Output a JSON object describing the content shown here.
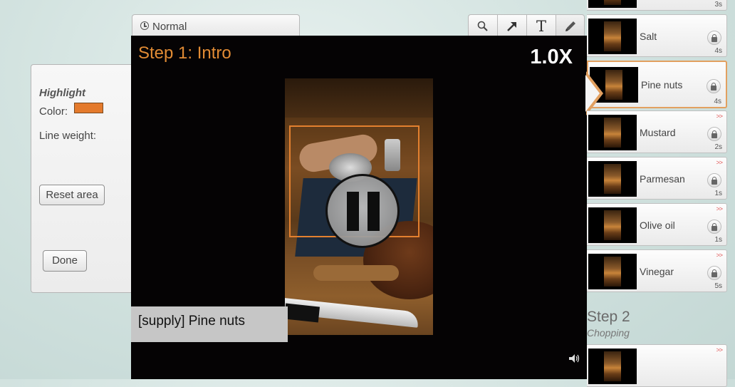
{
  "mode_tab": {
    "label": "Normal",
    "icon": "clock-icon"
  },
  "tools": [
    {
      "name": "search-tool-button",
      "icon": "magnifier-icon"
    },
    {
      "name": "arrow-tool-button",
      "icon": "arrow-icon"
    },
    {
      "name": "text-tool-button",
      "icon": "text-icon",
      "glyph": "T"
    },
    {
      "name": "pencil-tool-button",
      "icon": "pencil-icon"
    }
  ],
  "panel": {
    "title": "Highlight",
    "color_label": "Color:",
    "color_value": "#e47a2c",
    "line_weight_label": "Line weight:",
    "reset_label": "Reset area",
    "done_label": "Done"
  },
  "video": {
    "step_title": "Step 1: Intro",
    "speed": "1.0X",
    "caption": "[supply] Pine nuts",
    "highlight_color": "#e3802f",
    "state": "playing"
  },
  "steps_list": {
    "items": [
      {
        "name": "",
        "duration": "3s",
        "chevron": ""
      },
      {
        "name": "Salt",
        "duration": "4s",
        "chevron": ""
      },
      {
        "name": "Pine nuts",
        "duration": "4s",
        "chevron": ">>",
        "active": true
      },
      {
        "name": "Mustard",
        "duration": "2s",
        "chevron": ">>"
      },
      {
        "name": "Parmesan",
        "duration": "1s",
        "chevron": ">>"
      },
      {
        "name": "Olive oil",
        "duration": "1s",
        "chevron": ">>"
      },
      {
        "name": "Vinegar",
        "duration": "5s",
        "chevron": ">>"
      }
    ],
    "step2_title": "Step 2",
    "step2_subtitle": "Chopping",
    "step2_first_chevron": ">>"
  }
}
